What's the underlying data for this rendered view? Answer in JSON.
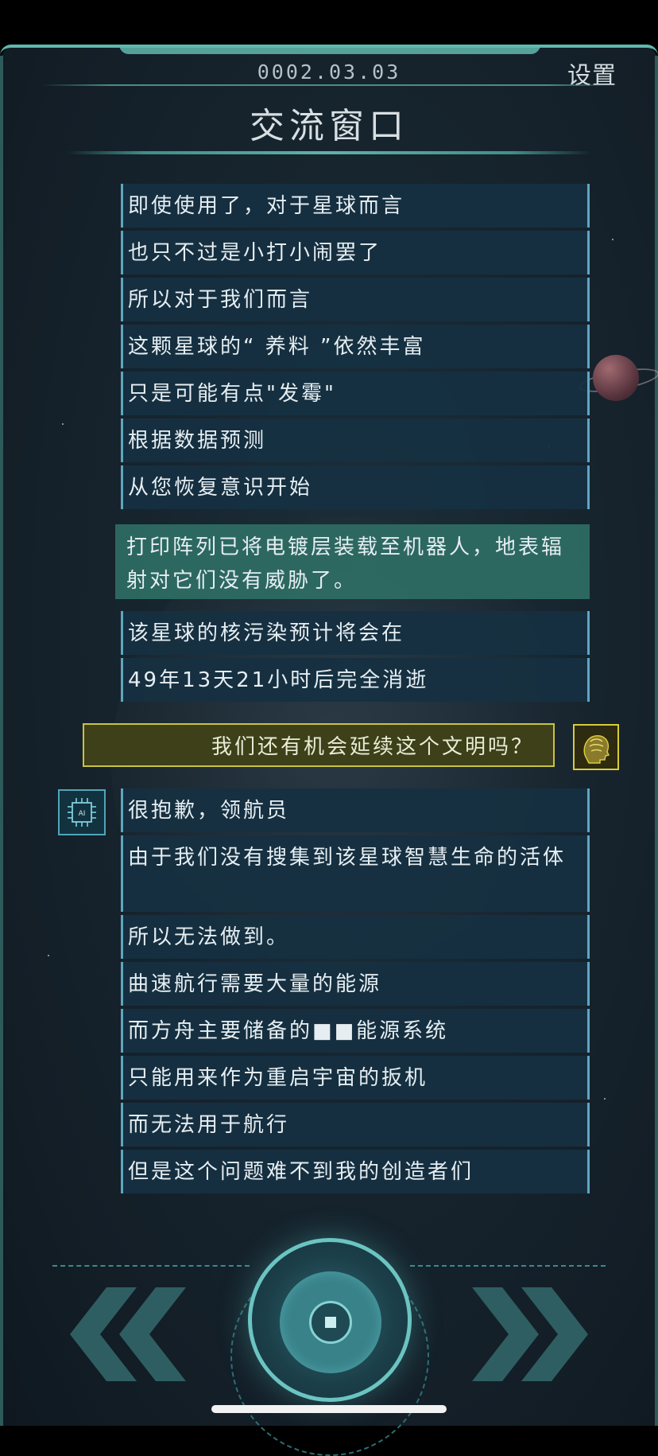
{
  "header": {
    "date": "0002.03.03",
    "settings_label": "设置",
    "title": "交流窗口"
  },
  "messages_top": [
    "即使使用了，对于星球而言",
    "也只不过是小打小闹罢了",
    "所以对于我们而言",
    "这颗星球的“ 养料 ”依然丰富",
    "只是可能有点\"发霉\"",
    "根据数据预测",
    "从您恢复意识开始"
  ],
  "highlight_message": "打印阵列已将电镀层装载至机器人，地表辐射对它们没有威胁了。",
  "messages_mid": [
    "该星球的核污染预计将会在",
    "49年13天21小时后完全消逝"
  ],
  "user_message": "我们还有机会延续这个文明吗？",
  "ai_avatar_label": "AI",
  "messages_bottom": [
    "很抱歉，领航员",
    "由于我们没有搜集到该星球智慧生命的活体",
    "所以无法做到。",
    "曲速航行需要大量的能源",
    "而方舟主要储备的■■能源系统",
    "只能用来作为重启宇宙的扳机",
    "而无法用于航行",
    "但是这个问题难不到我的创造者们"
  ],
  "colors": {
    "accent_teal": "#5fb8ad",
    "message_bg": "#163042",
    "message_border": "#5fa6bf",
    "highlight_bg": "#2f6e64",
    "user_border": "#c9c341"
  },
  "icons": [
    "brain-head-icon",
    "ai-chip-icon",
    "back-arrows-icon",
    "forward-arrows-icon",
    "center-button-icon"
  ]
}
